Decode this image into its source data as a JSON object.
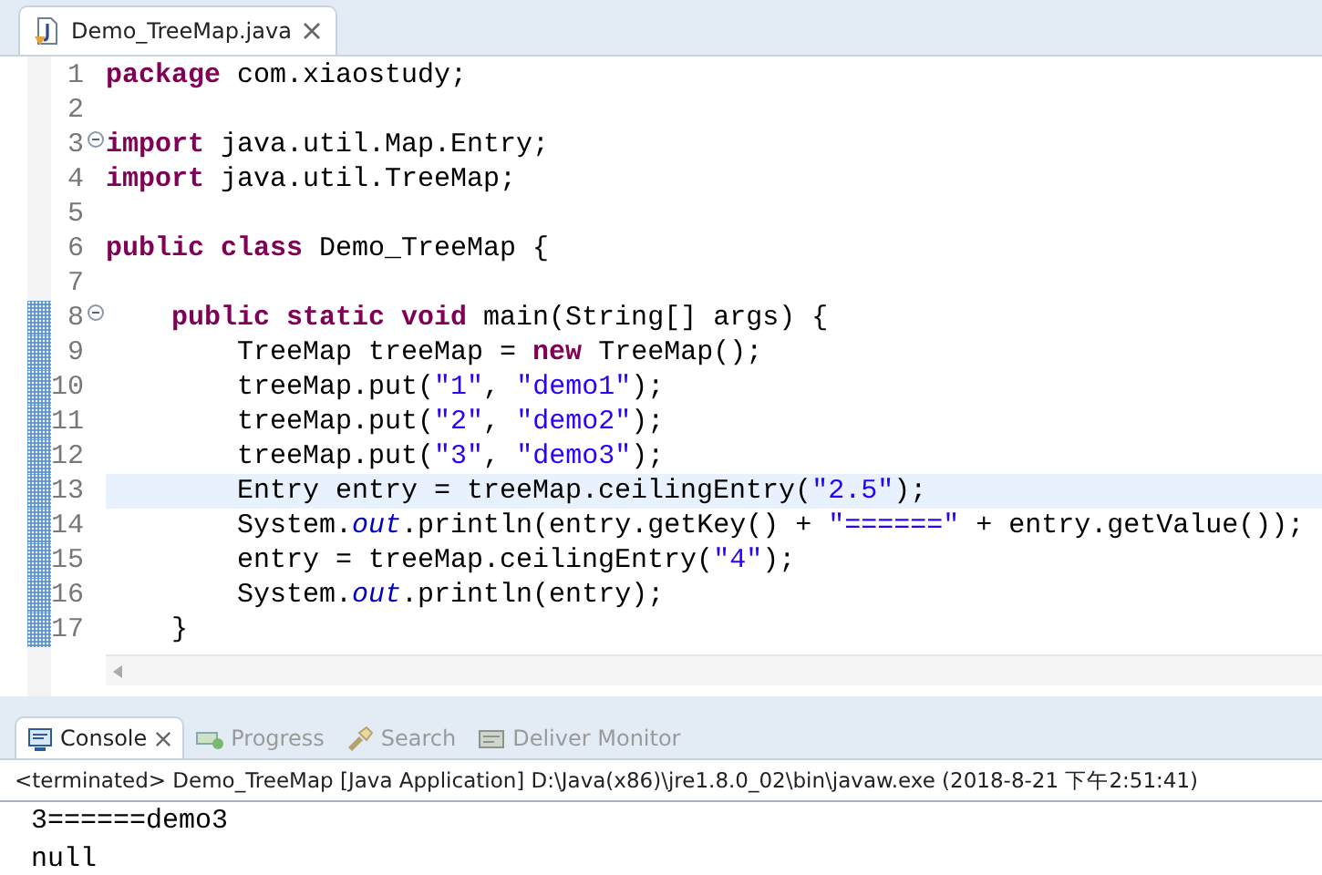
{
  "editor": {
    "tab": {
      "title": "Demo_TreeMap.java",
      "selected": true
    },
    "lines": [
      {
        "number": "1",
        "fold": false,
        "current": false,
        "changed": false,
        "tokens": [
          {
            "kind": "keyword",
            "text": "package"
          },
          {
            "kind": "plain",
            "text": " com.xiaostudy;"
          }
        ]
      },
      {
        "number": "2",
        "fold": false,
        "current": false,
        "changed": false
      },
      {
        "number": "3",
        "fold": true,
        "current": false,
        "changed": false,
        "tokens": [
          {
            "kind": "keyword",
            "text": "import"
          },
          {
            "kind": "plain",
            "text": " java.util.Map.Entry;"
          }
        ]
      },
      {
        "number": "4",
        "fold": false,
        "current": false,
        "changed": false,
        "tokens": [
          {
            "kind": "keyword",
            "text": "import"
          },
          {
            "kind": "plain",
            "text": " java.util.TreeMap;"
          }
        ]
      },
      {
        "number": "5",
        "fold": false,
        "current": false,
        "changed": false
      },
      {
        "number": "6",
        "fold": false,
        "current": false,
        "changed": false,
        "tokens": [
          {
            "kind": "keyword",
            "text": "public class"
          },
          {
            "kind": "plain",
            "text": " Demo_TreeMap {"
          }
        ]
      },
      {
        "number": "7",
        "fold": false,
        "current": false,
        "changed": false
      },
      {
        "number": "8",
        "fold": true,
        "current": false,
        "changed": true,
        "tokens": [
          {
            "kind": "keyword",
            "text": "    public static void"
          },
          {
            "kind": "plain",
            "text": " main(String[] args) {"
          }
        ]
      },
      {
        "number": "9",
        "fold": false,
        "current": false,
        "changed": true,
        "tokens": [
          {
            "kind": "plain",
            "text": "        TreeMap treeMap = "
          },
          {
            "kind": "keyword",
            "text": "new"
          },
          {
            "kind": "plain",
            "text": " TreeMap();"
          }
        ]
      },
      {
        "number": "10",
        "fold": false,
        "current": false,
        "changed": true,
        "tokens": [
          {
            "kind": "plain",
            "text": "        treeMap.put("
          },
          {
            "kind": "string",
            "text": "\"1\""
          },
          {
            "kind": "plain",
            "text": ", "
          },
          {
            "kind": "string",
            "text": "\"demo1\""
          },
          {
            "kind": "plain",
            "text": ");"
          }
        ]
      },
      {
        "number": "11",
        "fold": false,
        "current": false,
        "changed": true,
        "tokens": [
          {
            "kind": "plain",
            "text": "        treeMap.put("
          },
          {
            "kind": "string",
            "text": "\"2\""
          },
          {
            "kind": "plain",
            "text": ", "
          },
          {
            "kind": "string",
            "text": "\"demo2\""
          },
          {
            "kind": "plain",
            "text": ");"
          }
        ]
      },
      {
        "number": "12",
        "fold": false,
        "current": false,
        "changed": true,
        "tokens": [
          {
            "kind": "plain",
            "text": "        treeMap.put("
          },
          {
            "kind": "string",
            "text": "\"3\""
          },
          {
            "kind": "plain",
            "text": ", "
          },
          {
            "kind": "string",
            "text": "\"demo3\""
          },
          {
            "kind": "plain",
            "text": ");"
          }
        ]
      },
      {
        "number": "13",
        "fold": false,
        "current": true,
        "changed": true,
        "tokens": [
          {
            "kind": "plain",
            "text": "        Entry entry = treeMap.ceilingEntry("
          },
          {
            "kind": "string",
            "text": "\"2.5\""
          },
          {
            "kind": "plain",
            "text": ");"
          }
        ]
      },
      {
        "number": "14",
        "fold": false,
        "current": false,
        "changed": true,
        "tokens": [
          {
            "kind": "plain",
            "text": "        System."
          },
          {
            "kind": "field",
            "text": "out"
          },
          {
            "kind": "plain",
            "text": ".println(entry.getKey() + "
          },
          {
            "kind": "string",
            "text": "\"======\""
          },
          {
            "kind": "plain",
            "text": " + entry.getValue());"
          }
        ]
      },
      {
        "number": "15",
        "fold": false,
        "current": false,
        "changed": true,
        "tokens": [
          {
            "kind": "plain",
            "text": "        entry = treeMap.ceilingEntry("
          },
          {
            "kind": "string",
            "text": "\"4\""
          },
          {
            "kind": "plain",
            "text": ");"
          }
        ]
      },
      {
        "number": "16",
        "fold": false,
        "current": false,
        "changed": true,
        "tokens": [
          {
            "kind": "plain",
            "text": "        System."
          },
          {
            "kind": "field",
            "text": "out"
          },
          {
            "kind": "plain",
            "text": ".println(entry);"
          }
        ]
      },
      {
        "number": "17",
        "fold": false,
        "current": false,
        "changed": true,
        "tokens": [
          {
            "kind": "plain",
            "text": "    }"
          }
        ]
      }
    ]
  },
  "console": {
    "tabs": [
      {
        "label": "Console",
        "selected": true
      },
      {
        "label": "Progress",
        "selected": false
      },
      {
        "label": "Search",
        "selected": false
      },
      {
        "label": "Deliver Monitor",
        "selected": false
      }
    ],
    "status": "<terminated> Demo_TreeMap [Java Application] D:\\Java(x86)\\jre1.8.0_02\\bin\\javaw.exe (2018-8-21 下午2:51:41)",
    "output": [
      "3======demo3",
      "null"
    ]
  }
}
